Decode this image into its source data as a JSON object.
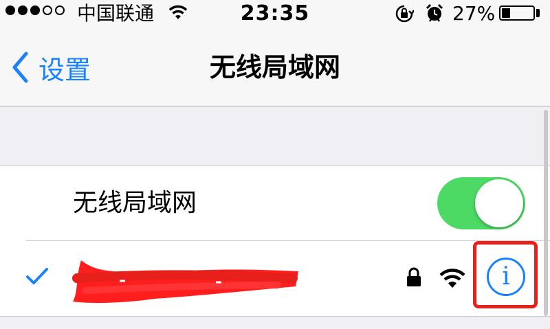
{
  "status_bar": {
    "signal_bars": 5,
    "signal_filled": 3,
    "carrier": "中国联通",
    "time": "23:35",
    "battery_percent": "27%",
    "battery_level": 0.27,
    "icons": [
      "signal-dots-icon",
      "wifi-icon",
      "rotation-lock-icon",
      "alarm-icon",
      "battery-icon"
    ]
  },
  "nav": {
    "back_label": "设置",
    "title": "无线局域网",
    "icons": [
      "chevron-left-icon"
    ]
  },
  "wifi_toggle": {
    "label": "无线局域网",
    "enabled": true
  },
  "network": {
    "connected": true,
    "ssid_redacted": true,
    "secured": true,
    "info_label": "i",
    "icons": [
      "checkmark-icon",
      "lock-icon",
      "wifi-signal-icon",
      "info-icon"
    ]
  },
  "colors": {
    "accent": "#1a82fb",
    "toggle_on": "#4cd964",
    "annotation_red": "#e8201c",
    "group_background": "#efeff4"
  }
}
